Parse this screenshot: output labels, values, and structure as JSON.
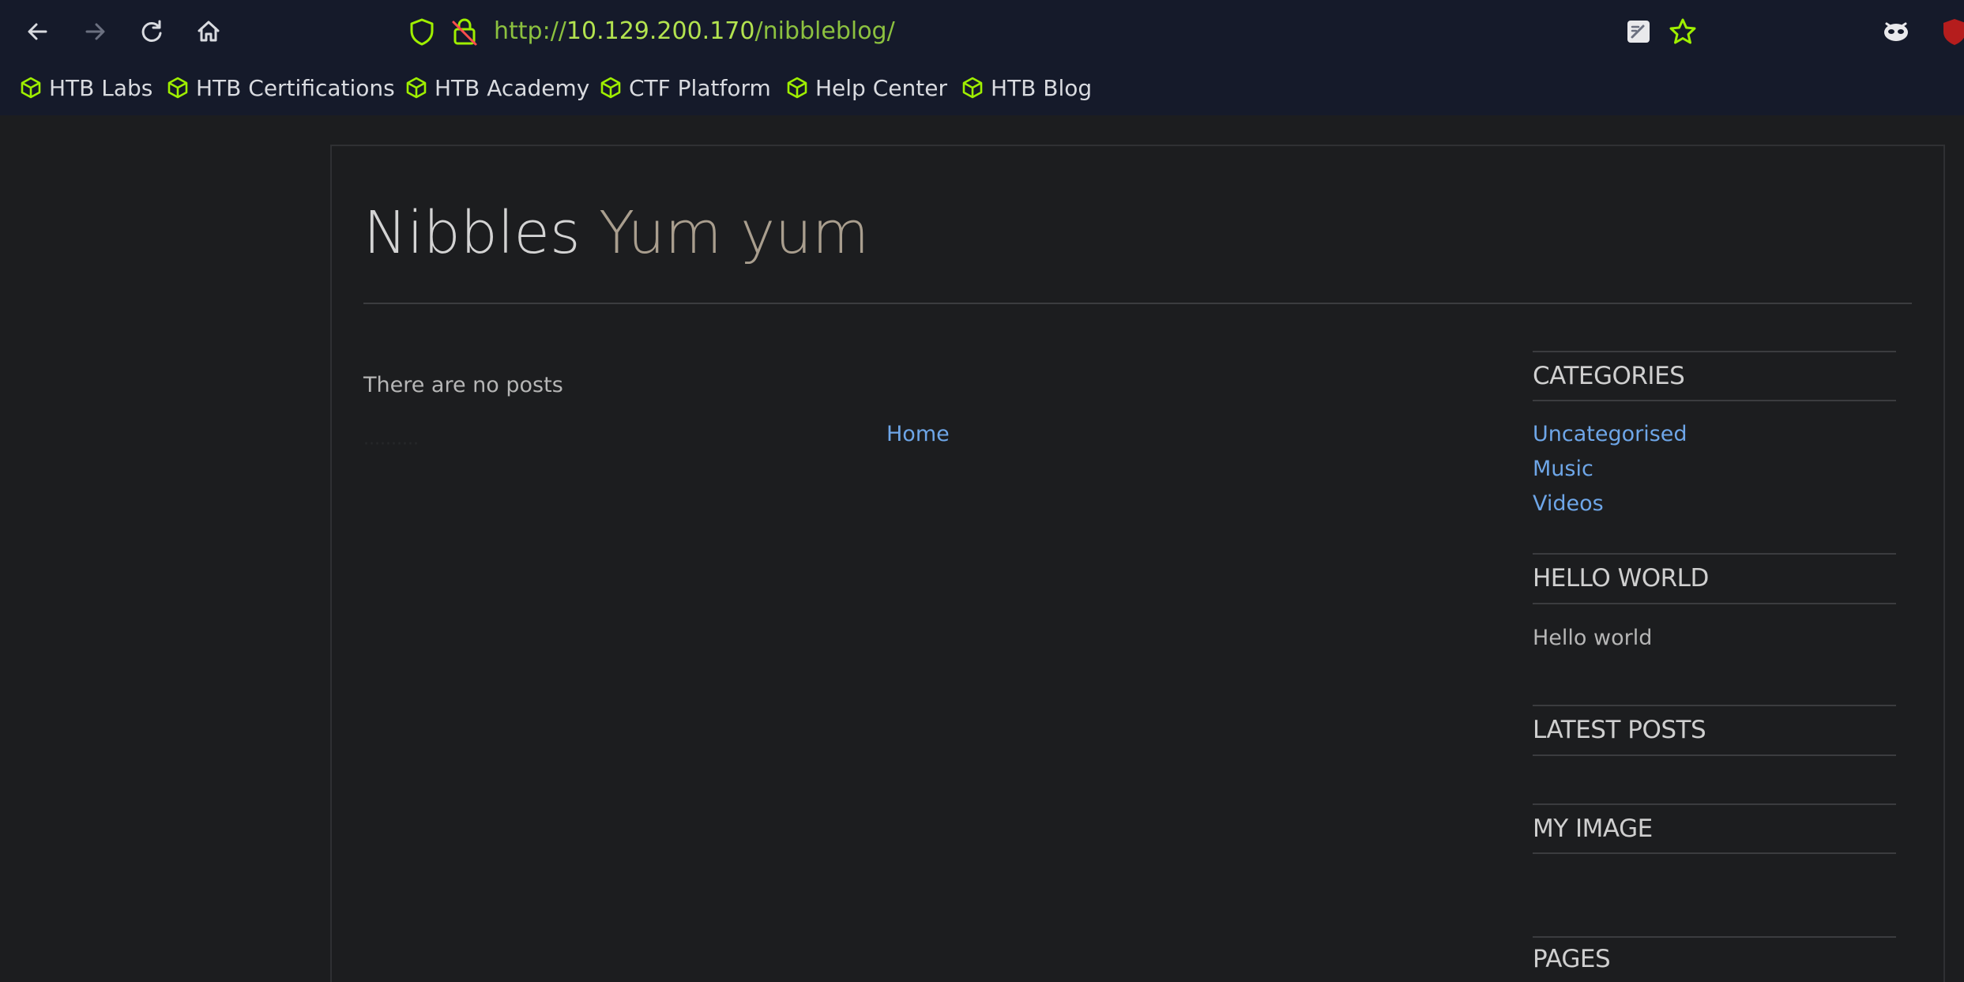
{
  "browser": {
    "url_scheme": "http://",
    "url_host": "10.129.200.170",
    "url_path": "/nibbleblog/",
    "bookmarks": [
      {
        "label": "HTB Labs",
        "icon": "htb-cube-icon"
      },
      {
        "label": "HTB Certifications",
        "icon": "htb-cube-icon"
      },
      {
        "label": "HTB Academy",
        "icon": "htb-cube-icon"
      },
      {
        "label": "CTF Platform",
        "icon": "htb-cube-icon"
      },
      {
        "label": "Help Center",
        "icon": "htb-cube-icon"
      },
      {
        "label": "HTB Blog",
        "icon": "htb-cube-icon"
      }
    ],
    "accent": "#9fef00"
  },
  "blog": {
    "name": "Nibbles",
    "slogan": "Yum yum",
    "empty_message": "There are no posts",
    "home_link": "Home"
  },
  "sidebar": {
    "categories_title": "CATEGORIES",
    "categories": [
      "Uncategorised",
      "Music",
      "Videos"
    ],
    "hello_title": "HELLO WORLD",
    "hello_text": "Hello world",
    "latest_title": "LATEST POSTS",
    "image_title": "MY IMAGE",
    "pages_title": "PAGES"
  }
}
